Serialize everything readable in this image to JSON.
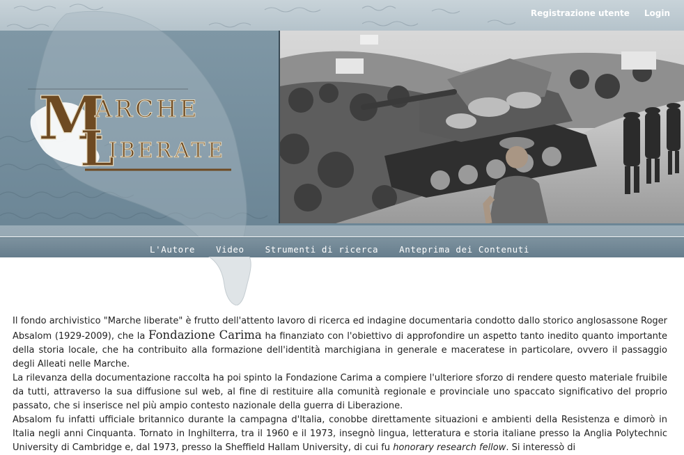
{
  "top_links": {
    "registration": "Registrazione utente",
    "login": "Login"
  },
  "logo": {
    "line1": "ARCHE",
    "line1_initial": "M",
    "line2": "IBERATE",
    "line2_initial": "L"
  },
  "nav": [
    {
      "label": "L'Autore"
    },
    {
      "label": "Video"
    },
    {
      "label": "Strumenti di ricerca"
    },
    {
      "label": "Anteprima dei Contenuti"
    }
  ],
  "content": {
    "p1_a": "Il fondo archivistico \"Marche liberate\" è frutto dell'attento lavoro di ricerca ed indagine documentaria condotto dallo storico anglosassone Roger Absalom (1929-2009), che la ",
    "p1_foundation": "Fondazione Carima",
    "p1_b": " ha finanziato con l'obiettivo di approfondire un aspetto tanto inedito quanto importante della storia locale, che ha contribuito alla formazione dell'identità marchigiana in generale e maceratese in particolare, ovvero il passaggio degli Alleati nelle Marche.",
    "p2": "La rilevanza della documentazione raccolta ha poi spinto la Fondazione Carima a compiere l'ulteriore sforzo di rendere questo materiale fruibile da tutti, attraverso la sua diffusione sul web, al fine di restituire alla comunità regionale e provinciale uno spaccato significativo del proprio passato, che si inserisce nel più ampio contesto nazionale della guerra di Liberazione.",
    "p3_a": "Absalom fu infatti ufficiale britannico durante la campagna d'Italia, conobbe direttamente situazioni e ambienti della Resistenza e dimorò in Italia negli anni Cinquanta. Tornato in Inghilterra, tra il 1960 e il 1973, insegnò lingua, letteratura e storia italiane presso la Anglia Polytechnic University di Cambridge e, dal 1973, presso la Sheffield Hallam University, di cui fu ",
    "p3_em": "honorary research fellow",
    "p3_b": ". Si interessò di"
  },
  "colors": {
    "header_band": "#6c8696",
    "nav_bar": "#667d8c",
    "logo_brown": "#6e4a22",
    "logo_cream": "#e8dcc0"
  }
}
